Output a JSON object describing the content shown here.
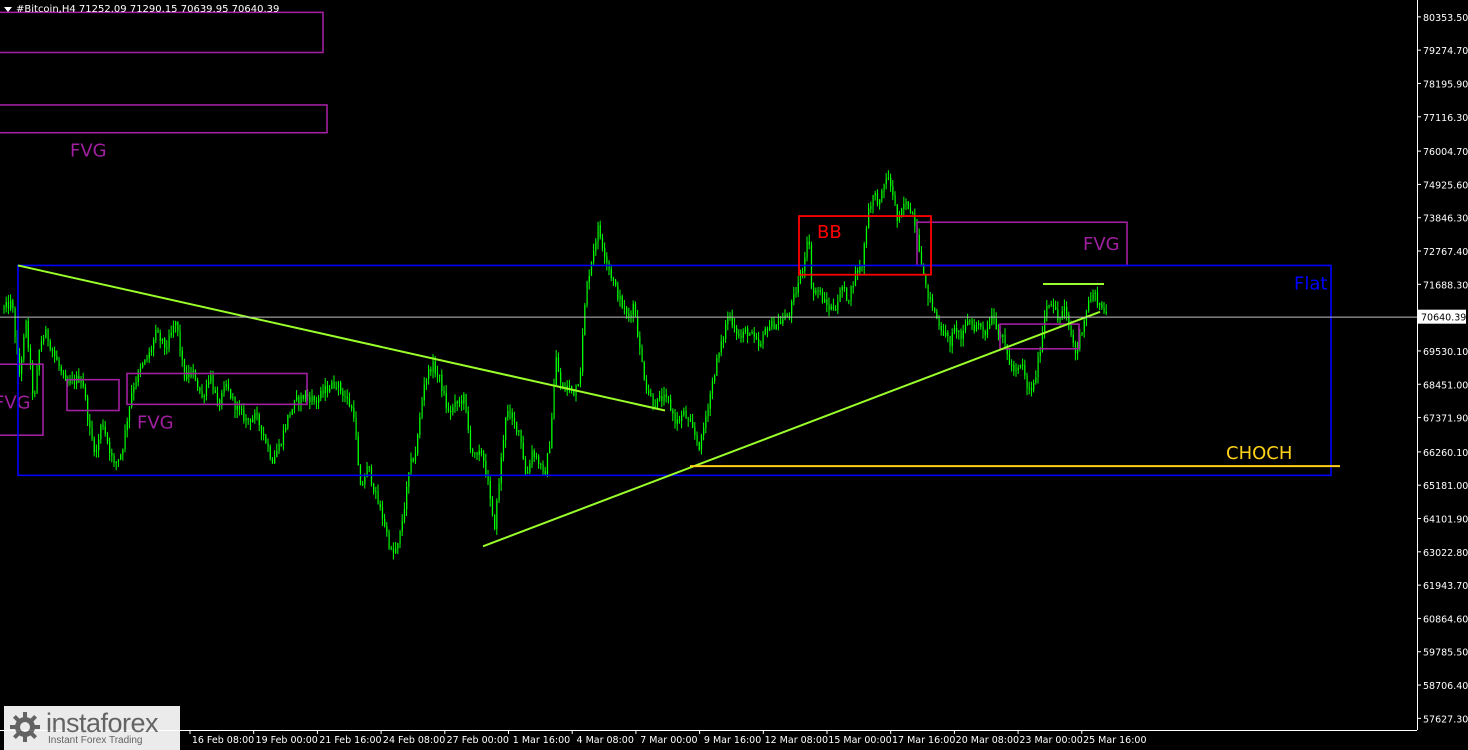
{
  "header": {
    "symbol": "#Bitcoin,H4",
    "open": "71252.09",
    "high": "71290.15",
    "low": "70639.95",
    "close": "70640.39"
  },
  "logo": {
    "name": "instaforex",
    "tagline": "Instant Forex Trading"
  },
  "colors": {
    "background": "#000000",
    "bull_candle": "#00ff00",
    "bear_candle": "#00ff00",
    "fvg": "#a020a0",
    "flat": "#0000ff",
    "bb": "#ff0000",
    "trendline": "#9aff2a",
    "choch": "#ffd21a",
    "price_line": "#c0c0c0",
    "axis": "#ffffff"
  },
  "chart_data": {
    "type": "candlestick",
    "timeframe": "H4",
    "y_tick_labels": [
      "80353.50",
      "79274.70",
      "78195.90",
      "77116.30",
      "76004.70",
      "74925.60",
      "73846.30",
      "72767.40",
      "71688.30",
      "70640.39",
      "69530.10",
      "68451.00",
      "67371.90",
      "66260.10",
      "65181.00",
      "64101.90",
      "63022.80",
      "61943.70",
      "60864.60",
      "59785.50",
      "58706.40",
      "57627.30"
    ],
    "x_tick_labels": [
      "16 Feb 08:00",
      "19 Feb 00:00",
      "21 Feb 16:00",
      "24 Feb 08:00",
      "27 Feb 00:00",
      "1 Mar 16:00",
      "4 Mar 08:00",
      "7 Mar 00:00",
      "9 Mar 16:00",
      "12 Mar 08:00",
      "15 Mar 00:00",
      "17 Mar 16:00",
      "20 Mar 08:00",
      "23 Mar 00:00",
      "25 Mar 16:00"
    ],
    "ylim": [
      57250,
      80900
    ],
    "current_price": 70640.39,
    "close_path": [
      [
        0,
        70900
      ],
      [
        8,
        71100
      ],
      [
        15,
        68700
      ],
      [
        22,
        70400
      ],
      [
        30,
        67800
      ],
      [
        36,
        69800
      ],
      [
        42,
        70100
      ],
      [
        55,
        69000
      ],
      [
        62,
        68400
      ],
      [
        72,
        68600
      ],
      [
        78,
        68700
      ],
      [
        86,
        66900
      ],
      [
        92,
        66200
      ],
      [
        98,
        67300
      ],
      [
        110,
        65800
      ],
      [
        118,
        66300
      ],
      [
        128,
        68300
      ],
      [
        136,
        68900
      ],
      [
        145,
        69400
      ],
      [
        152,
        70100
      ],
      [
        162,
        69600
      ],
      [
        172,
        70500
      ],
      [
        180,
        68700
      ],
      [
        190,
        68800
      ],
      [
        198,
        68000
      ],
      [
        206,
        68800
      ],
      [
        214,
        67700
      ],
      [
        222,
        68400
      ],
      [
        232,
        67700
      ],
      [
        242,
        67300
      ],
      [
        252,
        67400
      ],
      [
        260,
        66800
      ],
      [
        268,
        66000
      ],
      [
        276,
        66500
      ],
      [
        284,
        67400
      ],
      [
        292,
        67900
      ],
      [
        302,
        68100
      ],
      [
        312,
        67900
      ],
      [
        322,
        68300
      ],
      [
        332,
        68500
      ],
      [
        342,
        68000
      ],
      [
        350,
        67500
      ],
      [
        356,
        65000
      ],
      [
        364,
        65800
      ],
      [
        372,
        64800
      ],
      [
        380,
        64000
      ],
      [
        388,
        62900
      ],
      [
        394,
        63200
      ],
      [
        400,
        64400
      ],
      [
        406,
        65800
      ],
      [
        412,
        66300
      ],
      [
        420,
        68500
      ],
      [
        428,
        69100
      ],
      [
        436,
        68600
      ],
      [
        444,
        67500
      ],
      [
        452,
        67800
      ],
      [
        460,
        68000
      ],
      [
        466,
        66500
      ],
      [
        472,
        66000
      ],
      [
        478,
        66300
      ],
      [
        484,
        65200
      ],
      [
        490,
        63700
      ],
      [
        496,
        65600
      ],
      [
        502,
        67600
      ],
      [
        508,
        67300
      ],
      [
        516,
        66900
      ],
      [
        522,
        65400
      ],
      [
        528,
        66300
      ],
      [
        534,
        66000
      ],
      [
        540,
        65400
      ],
      [
        546,
        66600
      ],
      [
        552,
        69300
      ],
      [
        558,
        68200
      ],
      [
        564,
        68400
      ],
      [
        570,
        68200
      ],
      [
        576,
        68800
      ],
      [
        582,
        71500
      ],
      [
        588,
        72600
      ],
      [
        594,
        73500
      ],
      [
        600,
        72800
      ],
      [
        606,
        72100
      ],
      [
        612,
        71500
      ],
      [
        618,
        71000
      ],
      [
        624,
        70600
      ],
      [
        630,
        71100
      ],
      [
        636,
        69500
      ],
      [
        642,
        68400
      ],
      [
        650,
        67800
      ],
      [
        658,
        68000
      ],
      [
        664,
        67900
      ],
      [
        672,
        67200
      ],
      [
        680,
        67500
      ],
      [
        688,
        67000
      ],
      [
        696,
        66400
      ],
      [
        704,
        67800
      ],
      [
        712,
        69100
      ],
      [
        718,
        69800
      ],
      [
        724,
        70700
      ],
      [
        730,
        70400
      ],
      [
        736,
        69900
      ],
      [
        742,
        70200
      ],
      [
        748,
        70000
      ],
      [
        756,
        69600
      ],
      [
        762,
        70300
      ],
      [
        770,
        70400
      ],
      [
        778,
        70500
      ],
      [
        786,
        70800
      ],
      [
        794,
        71700
      ],
      [
        800,
        72400
      ],
      [
        804,
        73500
      ],
      [
        808,
        71400
      ],
      [
        814,
        71500
      ],
      [
        820,
        71100
      ],
      [
        826,
        70900
      ],
      [
        832,
        71000
      ],
      [
        838,
        71600
      ],
      [
        844,
        71200
      ],
      [
        852,
        72100
      ],
      [
        858,
        72300
      ],
      [
        864,
        74100
      ],
      [
        870,
        74600
      ],
      [
        876,
        74300
      ],
      [
        882,
        75200
      ],
      [
        888,
        74800
      ],
      [
        894,
        73600
      ],
      [
        900,
        74300
      ],
      [
        906,
        74200
      ],
      [
        912,
        73600
      ],
      [
        918,
        72300
      ],
      [
        922,
        71500
      ],
      [
        928,
        71000
      ],
      [
        934,
        70500
      ],
      [
        940,
        70100
      ],
      [
        946,
        69800
      ],
      [
        952,
        70300
      ],
      [
        958,
        69900
      ],
      [
        964,
        70600
      ],
      [
        970,
        70300
      ],
      [
        976,
        70400
      ],
      [
        982,
        70100
      ],
      [
        988,
        70800
      ],
      [
        994,
        70200
      ],
      [
        1000,
        69800
      ],
      [
        1006,
        69100
      ],
      [
        1012,
        68800
      ],
      [
        1018,
        69100
      ],
      [
        1024,
        68200
      ],
      [
        1030,
        68400
      ],
      [
        1036,
        69600
      ],
      [
        1042,
        71000
      ],
      [
        1048,
        71200
      ],
      [
        1054,
        70500
      ],
      [
        1060,
        70900
      ],
      [
        1066,
        70200
      ],
      [
        1072,
        69400
      ],
      [
        1078,
        70300
      ],
      [
        1084,
        71100
      ],
      [
        1090,
        71400
      ],
      [
        1096,
        71000
      ],
      [
        1100,
        70900
      ],
      [
        1104,
        70640
      ]
    ],
    "annotations": {
      "fvg_zones": [
        {
          "label": "FVG",
          "x0": 0,
          "x1": 323,
          "y0": 80500,
          "y1": 79200,
          "show_label": false
        },
        {
          "label": "FVG",
          "x0": 0,
          "x1": 327,
          "y0": 77500,
          "y1": 76600,
          "label_at": "bottom-left"
        },
        {
          "label": "FVG",
          "x0": 0,
          "x1": 43,
          "y0": 69100,
          "y1": 66800,
          "label_at": "left"
        },
        {
          "label": "FVG",
          "x0": 67,
          "x1": 119,
          "y0": 68600,
          "y1": 67600,
          "show_label": false
        },
        {
          "label": "FVG",
          "x0": 127,
          "x1": 307,
          "y0": 68800,
          "y1": 67800,
          "label_at": "bottom"
        },
        {
          "label": "FVG",
          "x0": 917,
          "x1": 1127,
          "y0": 73700,
          "y1": 72300,
          "label_at": "right"
        },
        {
          "label": "",
          "x0": 1000,
          "x1": 1079,
          "y0": 70400,
          "y1": 69600,
          "show_label": false
        }
      ],
      "flat": {
        "label": "Flat",
        "x0": 18,
        "x1": 1331,
        "y0": 72300,
        "y1": 65500
      },
      "bb": {
        "label": "BB",
        "x0": 799,
        "x1": 931,
        "y0": 73900,
        "y1": 72000
      },
      "choch": {
        "label": "CHOCH",
        "x0": 690,
        "x1": 1340,
        "y": 65800
      },
      "trendlines": [
        {
          "x0": 18,
          "y0": 72300,
          "x1": 665,
          "y1": 67600
        },
        {
          "x0": 483,
          "y0": 63200,
          "x1": 1100,
          "y1": 70800
        },
        {
          "x0": 1043,
          "y0": 71700,
          "x1": 1104,
          "y1": 71700
        }
      ]
    }
  }
}
